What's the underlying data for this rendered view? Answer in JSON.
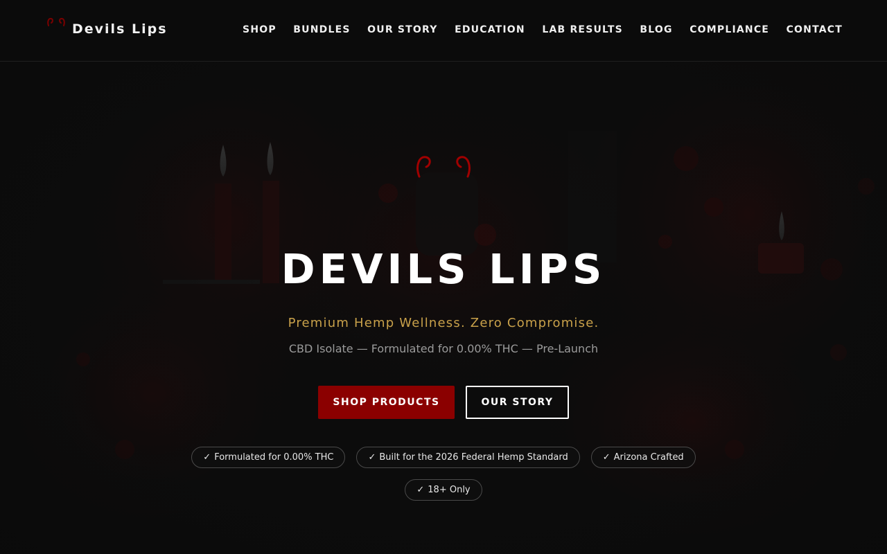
{
  "header": {
    "brand_name": "Devils Lips",
    "nav": [
      "SHOP",
      "BUNDLES",
      "OUR STORY",
      "EDUCATION",
      "LAB RESULTS",
      "BLOG",
      "COMPLIANCE",
      "CONTACT"
    ]
  },
  "hero": {
    "title": "DEVILS LIPS",
    "tagline": "Premium Hemp Wellness. Zero Compromise.",
    "subtitle": "CBD Isolate — Formulated for 0.00% THC — Pre-Launch",
    "primary_button": "SHOP PRODUCTS",
    "secondary_button": "OUR STORY",
    "badges": [
      "Formulated for 0.00% THC",
      "Built for the 2026 Federal Hemp Standard",
      "Arizona Crafted",
      "18+ Only"
    ],
    "badge_check": "✓"
  },
  "colors": {
    "background": "#0d0d0d",
    "accent_red": "#8b0000",
    "gold": "#c9a14a",
    "muted_text": "#9b9b9b"
  }
}
